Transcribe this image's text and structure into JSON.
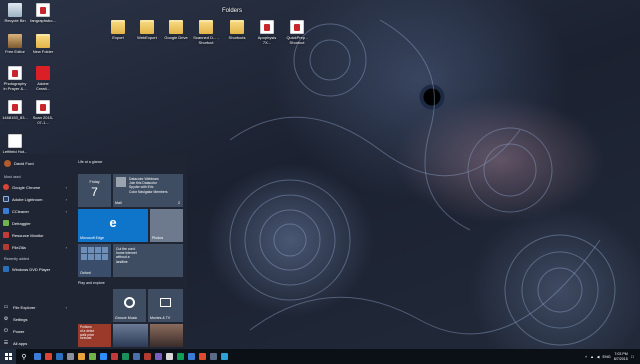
{
  "desktop": {
    "folders_label": "Folders",
    "icons": [
      {
        "label": "Recycle Bin",
        "icon": "recycle-bin-icon"
      },
      {
        "label": "fangraphsbo...",
        "icon": "pdf-icon"
      },
      {
        "label": "Free Editor",
        "icon": "tool-icon"
      },
      {
        "label": "New Folder",
        "icon": "folder-icon"
      },
      {
        "label": "Photography in Prayer &...",
        "icon": "pdf-icon"
      },
      {
        "label": "Adobe Creati...",
        "icon": "creative-cloud-icon"
      },
      {
        "label": "1468153_83...",
        "icon": "pdf-icon"
      },
      {
        "label": "Scan 2015-07-1...",
        "icon": "pdf-icon"
      },
      {
        "label": "Leftfield Hot...",
        "icon": "document-icon"
      },
      {
        "label": "Export",
        "icon": "folder-icon"
      },
      {
        "label": "WebExport",
        "icon": "folder-icon"
      },
      {
        "label": "Google Drive",
        "icon": "folder-icon"
      },
      {
        "label": "Scanned D... - Shortcut",
        "icon": "folder-icon"
      },
      {
        "label": "Shortcuts",
        "icon": "folder-icon"
      },
      {
        "label": "Apophysis 7X...",
        "icon": "pdf-icon"
      },
      {
        "label": "QuickPrep - Shortcut",
        "icon": "pdf-icon"
      }
    ]
  },
  "start_menu": {
    "user_name": "David Ford",
    "most_used_label": "Most used",
    "apps": [
      {
        "label": "Google Chrome",
        "color": "#db4437",
        "has_submenu": true
      },
      {
        "label": "Adobe Lightroom",
        "color": "#2b3a55",
        "has_submenu": true
      },
      {
        "label": "CCleaner",
        "color": "#3a7bd5",
        "has_submenu": true
      },
      {
        "label": "Defraggler",
        "color": "#6fb34a",
        "has_submenu": false
      },
      {
        "label": "Resource Monitor",
        "color": "#c23b3b",
        "has_submenu": false
      },
      {
        "label": "FileZilla",
        "color": "#b33a2e",
        "has_submenu": true
      }
    ],
    "recently_added_label": "Recently added",
    "recent_apps": [
      {
        "label": "Windows DVD Player",
        "color": "#2a6fb8"
      }
    ],
    "bottom_items": [
      {
        "label": "File Explorer",
        "symbol": "▭",
        "has_submenu": true
      },
      {
        "label": "Settings",
        "symbol": "⚙",
        "has_submenu": false
      },
      {
        "label": "Power",
        "symbol": "⏻",
        "has_submenu": false
      },
      {
        "label": "All apps",
        "symbol": "☰",
        "has_submenu": false
      }
    ],
    "life_group_label": "Life at a glance",
    "play_group_label": "Play and explore",
    "tiles": {
      "calendar_dow": "Friday",
      "calendar_day": "7",
      "mail_lines": [
        "Datacolor Webinars",
        "Join this Datacolor",
        "Spyder with Eric",
        "Color Navigator Members"
      ],
      "mail_label": "Mail",
      "mail_count": "2",
      "edge_glyph": "e",
      "edge_label": "Microsoft Edge",
      "photos_label": "Photos",
      "weather_label": "Oxford",
      "news_lines": [
        "Cut the cord:",
        "home internet",
        "without a",
        "landline"
      ],
      "groove_label": "Groove Music",
      "movies_label": "Movies & TV",
      "headline_lines": [
        "Portions",
        "of a debut",
        "walk price",
        "forecast"
      ]
    }
  },
  "taskbar": {
    "search_symbol": "⚲",
    "pinned_colors": [
      "#3c7bd9",
      "#db4437",
      "#2b6fbf",
      "#8a8fa0",
      "#e8a33c",
      "#6fb34a",
      "#2d8cff",
      "#c23b3b",
      "#1a8f5a",
      "#4a6ea8",
      "#b33a2e",
      "#7b5fbf",
      "#d8d8d8",
      "#0f9d58",
      "#3a7bd5",
      "#e04a2f",
      "#5a6b85",
      "#2aa1d8"
    ],
    "language": "ENG",
    "time": "7:03 PM",
    "date": "8/7/2015"
  }
}
